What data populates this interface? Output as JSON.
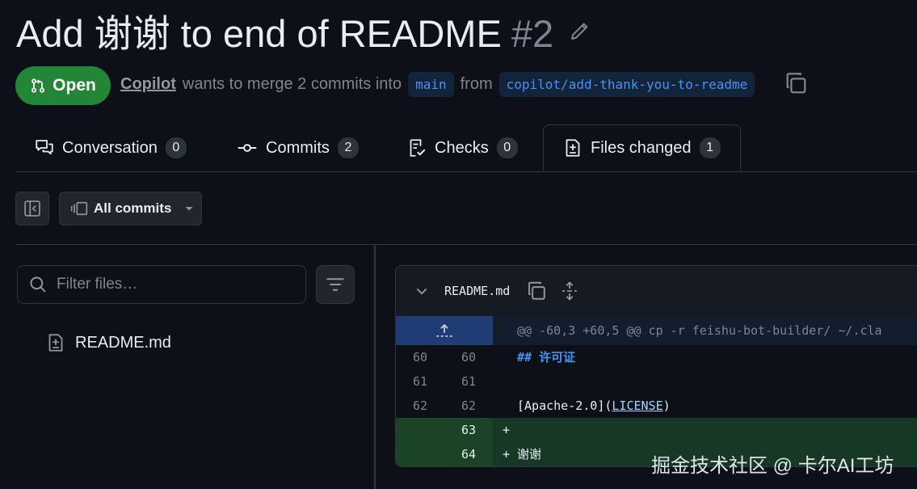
{
  "pr": {
    "title": "Add 谢谢 to end of README",
    "number": "#2",
    "state": "Open",
    "author": "Copilot",
    "merge_text": "wants to merge 2 commits into",
    "base_branch": "main",
    "from_text": "from",
    "head_branch": "copilot/add-thank-you-to-readme"
  },
  "tabs": [
    {
      "label": "Conversation",
      "count": "0",
      "icon": "comment-discussion-icon"
    },
    {
      "label": "Commits",
      "count": "2",
      "icon": "git-commit-icon"
    },
    {
      "label": "Checks",
      "count": "0",
      "icon": "checklist-icon"
    },
    {
      "label": "Files changed",
      "count": "1",
      "icon": "file-diff-icon",
      "selected": true
    }
  ],
  "toolbar": {
    "commits_filter": "All commits"
  },
  "file_tree": {
    "filter_placeholder": "Filter files…",
    "files": [
      {
        "name": "README.md"
      }
    ]
  },
  "diff": {
    "file_name": "README.md",
    "hunk_header": "@@ -60,3 +60,5 @@ cp -r feishu-bot-builder/ ~/.cla",
    "lines": [
      {
        "old": "60",
        "new": "60",
        "prefix": "",
        "text": "## 许可证",
        "type": "context"
      },
      {
        "old": "61",
        "new": "61",
        "prefix": "",
        "text": "",
        "type": "context"
      },
      {
        "old": "62",
        "new": "62",
        "prefix": "",
        "text_before": "[Apache-2.0](",
        "link": "LICENSE",
        "text_after": ")",
        "type": "context"
      },
      {
        "old": "",
        "new": "63",
        "prefix": "+",
        "text": "",
        "type": "add"
      },
      {
        "old": "",
        "new": "64",
        "prefix": "+",
        "text": "谢谢",
        "type": "add"
      }
    ]
  },
  "watermark": "掘金技术社区 @ 卡尔AI工坊",
  "colors": {
    "open_green": "#238636",
    "link_blue": "#4493f8",
    "background": "#0d1117",
    "added_line": "#173824"
  }
}
